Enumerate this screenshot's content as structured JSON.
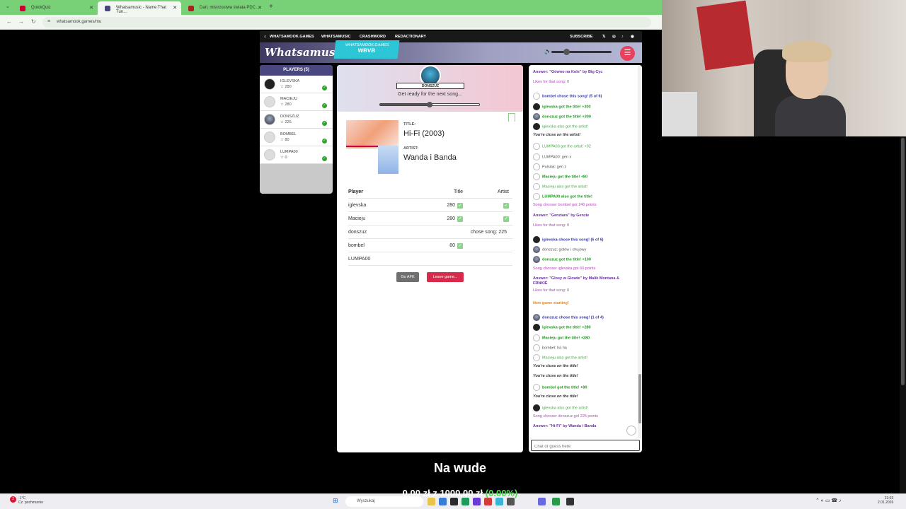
{
  "browser": {
    "tabs": [
      {
        "label": "QuickQuiz",
        "active": false
      },
      {
        "label": "Whatsamusic - Name That Tun…",
        "active": true
      },
      {
        "label": "Dari, mistrzostwa świata PDC…",
        "active": false
      }
    ],
    "url": "whatsamook.games/mu"
  },
  "site": {
    "nav": [
      "WHATSAMOOK.GAMES",
      "WHATSAMUSIC",
      "CRASHWORD",
      "REDACTIONARY"
    ],
    "subscribe": "SUBSCRIBE",
    "logo": "Whatsamusic",
    "tag_line1": "WHATSAMOOK.GAMES",
    "tag_line2": "WBVB",
    "volume_level": 0.2
  },
  "players": {
    "header": "PLAYERS (5)",
    "list": [
      {
        "name": "IGLEVSKA",
        "points": "☆ 280"
      },
      {
        "name": "MACIEJU",
        "points": "☆ 280"
      },
      {
        "name": "DONSZUZ",
        "points": "☆ 225"
      },
      {
        "name": "BOMBEL",
        "points": "☆ 80"
      },
      {
        "name": "LUMPA00",
        "points": "☆ 0"
      }
    ]
  },
  "game": {
    "host": "DONSZUZ",
    "status": "Get ready for the next song...",
    "progress": 0.5,
    "title_label": "TITLE:",
    "title": "Hi-Fi (2003)",
    "artist_label": "ARTIST:",
    "artist": "Wanda i Banda",
    "table_head": {
      "player": "Player",
      "title": "Title",
      "artist": "Artist"
    },
    "rows": [
      {
        "player": "iglevska",
        "title": "280",
        "title_check": true,
        "artist_check": true
      },
      {
        "player": "Macieju",
        "title": "280",
        "title_check": true,
        "artist_check": true
      },
      {
        "player": "donszuz",
        "title": "chose song: 225",
        "title_check": false,
        "artist_check": false
      },
      {
        "player": "bombel",
        "title": "80",
        "title_check": true,
        "artist_check": false
      },
      {
        "player": "LUMPA00",
        "title": "",
        "title_check": false,
        "artist_check": false
      }
    ],
    "afk_label": "Go AFK",
    "leave_label": "Leave game..."
  },
  "chat": {
    "messages": [
      {
        "type": "answer",
        "icon": "",
        "text": "Answer: \"Gówno na Kole\" by Big Cyc"
      },
      {
        "type": "likes",
        "icon": "",
        "text": "Likes for that song: 0"
      },
      {
        "type": "chose",
        "icon": "grey",
        "text": "bombel chose this song! (5 of 6)"
      },
      {
        "type": "got",
        "icon": "black",
        "text": "iglevska got the title! +300"
      },
      {
        "type": "got",
        "icon": "photo",
        "text": "donszuz got the title! +300"
      },
      {
        "type": "also",
        "icon": "black",
        "text": "iglevska also got the artist!"
      },
      {
        "type": "close",
        "icon": "",
        "text": "You're close on the artist!"
      },
      {
        "type": "also",
        "icon": "grey",
        "text": "LUMPA00 got the artist! +92"
      },
      {
        "type": "plain",
        "icon": "grey",
        "text": "LUMPA00: gen x"
      },
      {
        "type": "plain",
        "icon": "grey",
        "text": "Pulsiak: gen z"
      },
      {
        "type": "got",
        "icon": "grey",
        "text": "Macieju got the title! +80"
      },
      {
        "type": "also",
        "icon": "grey",
        "text": "Macieju also got the artist!"
      },
      {
        "type": "got",
        "icon": "grey",
        "text": "LUMPA00 also got the title!"
      },
      {
        "type": "song",
        "icon": "",
        "text": "Song chooser bombel got 240 points"
      },
      {
        "type": "answer",
        "icon": "",
        "text": "Answer: \"Genziara\" by Genzie"
      },
      {
        "type": "likes",
        "icon": "",
        "text": "Likes for that song: 0"
      },
      {
        "type": "chose",
        "icon": "black",
        "text": "iglevska chose this song! (6 of 6)"
      },
      {
        "type": "plain",
        "icon": "photo",
        "text": "donszuz: gotów i chujowy"
      },
      {
        "type": "got",
        "icon": "photo",
        "text": "donszuz got the title! +100"
      },
      {
        "type": "song",
        "icon": "",
        "text": "Song chooser iglevska got 60 points"
      },
      {
        "type": "answer",
        "icon": "",
        "text": "Answer: \"Glosy w Glowie\" by Malik Montana & FRNKIE"
      },
      {
        "type": "likes",
        "icon": "",
        "text": "Likes for that song: 0"
      },
      {
        "type": "new",
        "icon": "",
        "text": "New game starting!"
      },
      {
        "type": "chose",
        "icon": "photo",
        "text": "donszuz chose this song! (1 of 4)"
      },
      {
        "type": "got",
        "icon": "black",
        "text": "iglevska got the title! +280"
      },
      {
        "type": "got",
        "icon": "grey",
        "text": "Macieju got the title! +280"
      },
      {
        "type": "plain",
        "icon": "grey",
        "text": "bombel: ha ha"
      },
      {
        "type": "also",
        "icon": "grey",
        "text": "Macieju also got the artist!"
      },
      {
        "type": "close",
        "icon": "",
        "text": "You're close on the title!"
      },
      {
        "type": "close",
        "icon": "",
        "text": "You're close on the title!"
      },
      {
        "type": "got",
        "icon": "grey",
        "text": "bombel got the title! +80"
      },
      {
        "type": "close",
        "icon": "",
        "text": "You're close on the title!"
      },
      {
        "type": "also",
        "icon": "black",
        "text": "iglevska also got the artist!"
      },
      {
        "type": "song",
        "icon": "",
        "text": "Song chooser donszuz got 225 points"
      },
      {
        "type": "answer",
        "icon": "",
        "text": "Answer: \"Hi-Fi\" by Wanda i Banda"
      }
    ],
    "input_placeholder": "Chat or guess here"
  },
  "overlay": {
    "subtitle": "Na wude",
    "donation": "0,00 zł",
    "z_word": "z",
    "goal": "1000,00 zł",
    "percent": "(0.00%)"
  },
  "taskbar": {
    "weather_temp": "-1°C",
    "weather_text": "Cz. pochmurnie",
    "badge": "2",
    "search_placeholder": "Wyszukaj",
    "time": "21:03",
    "date": "2.01.2026"
  }
}
